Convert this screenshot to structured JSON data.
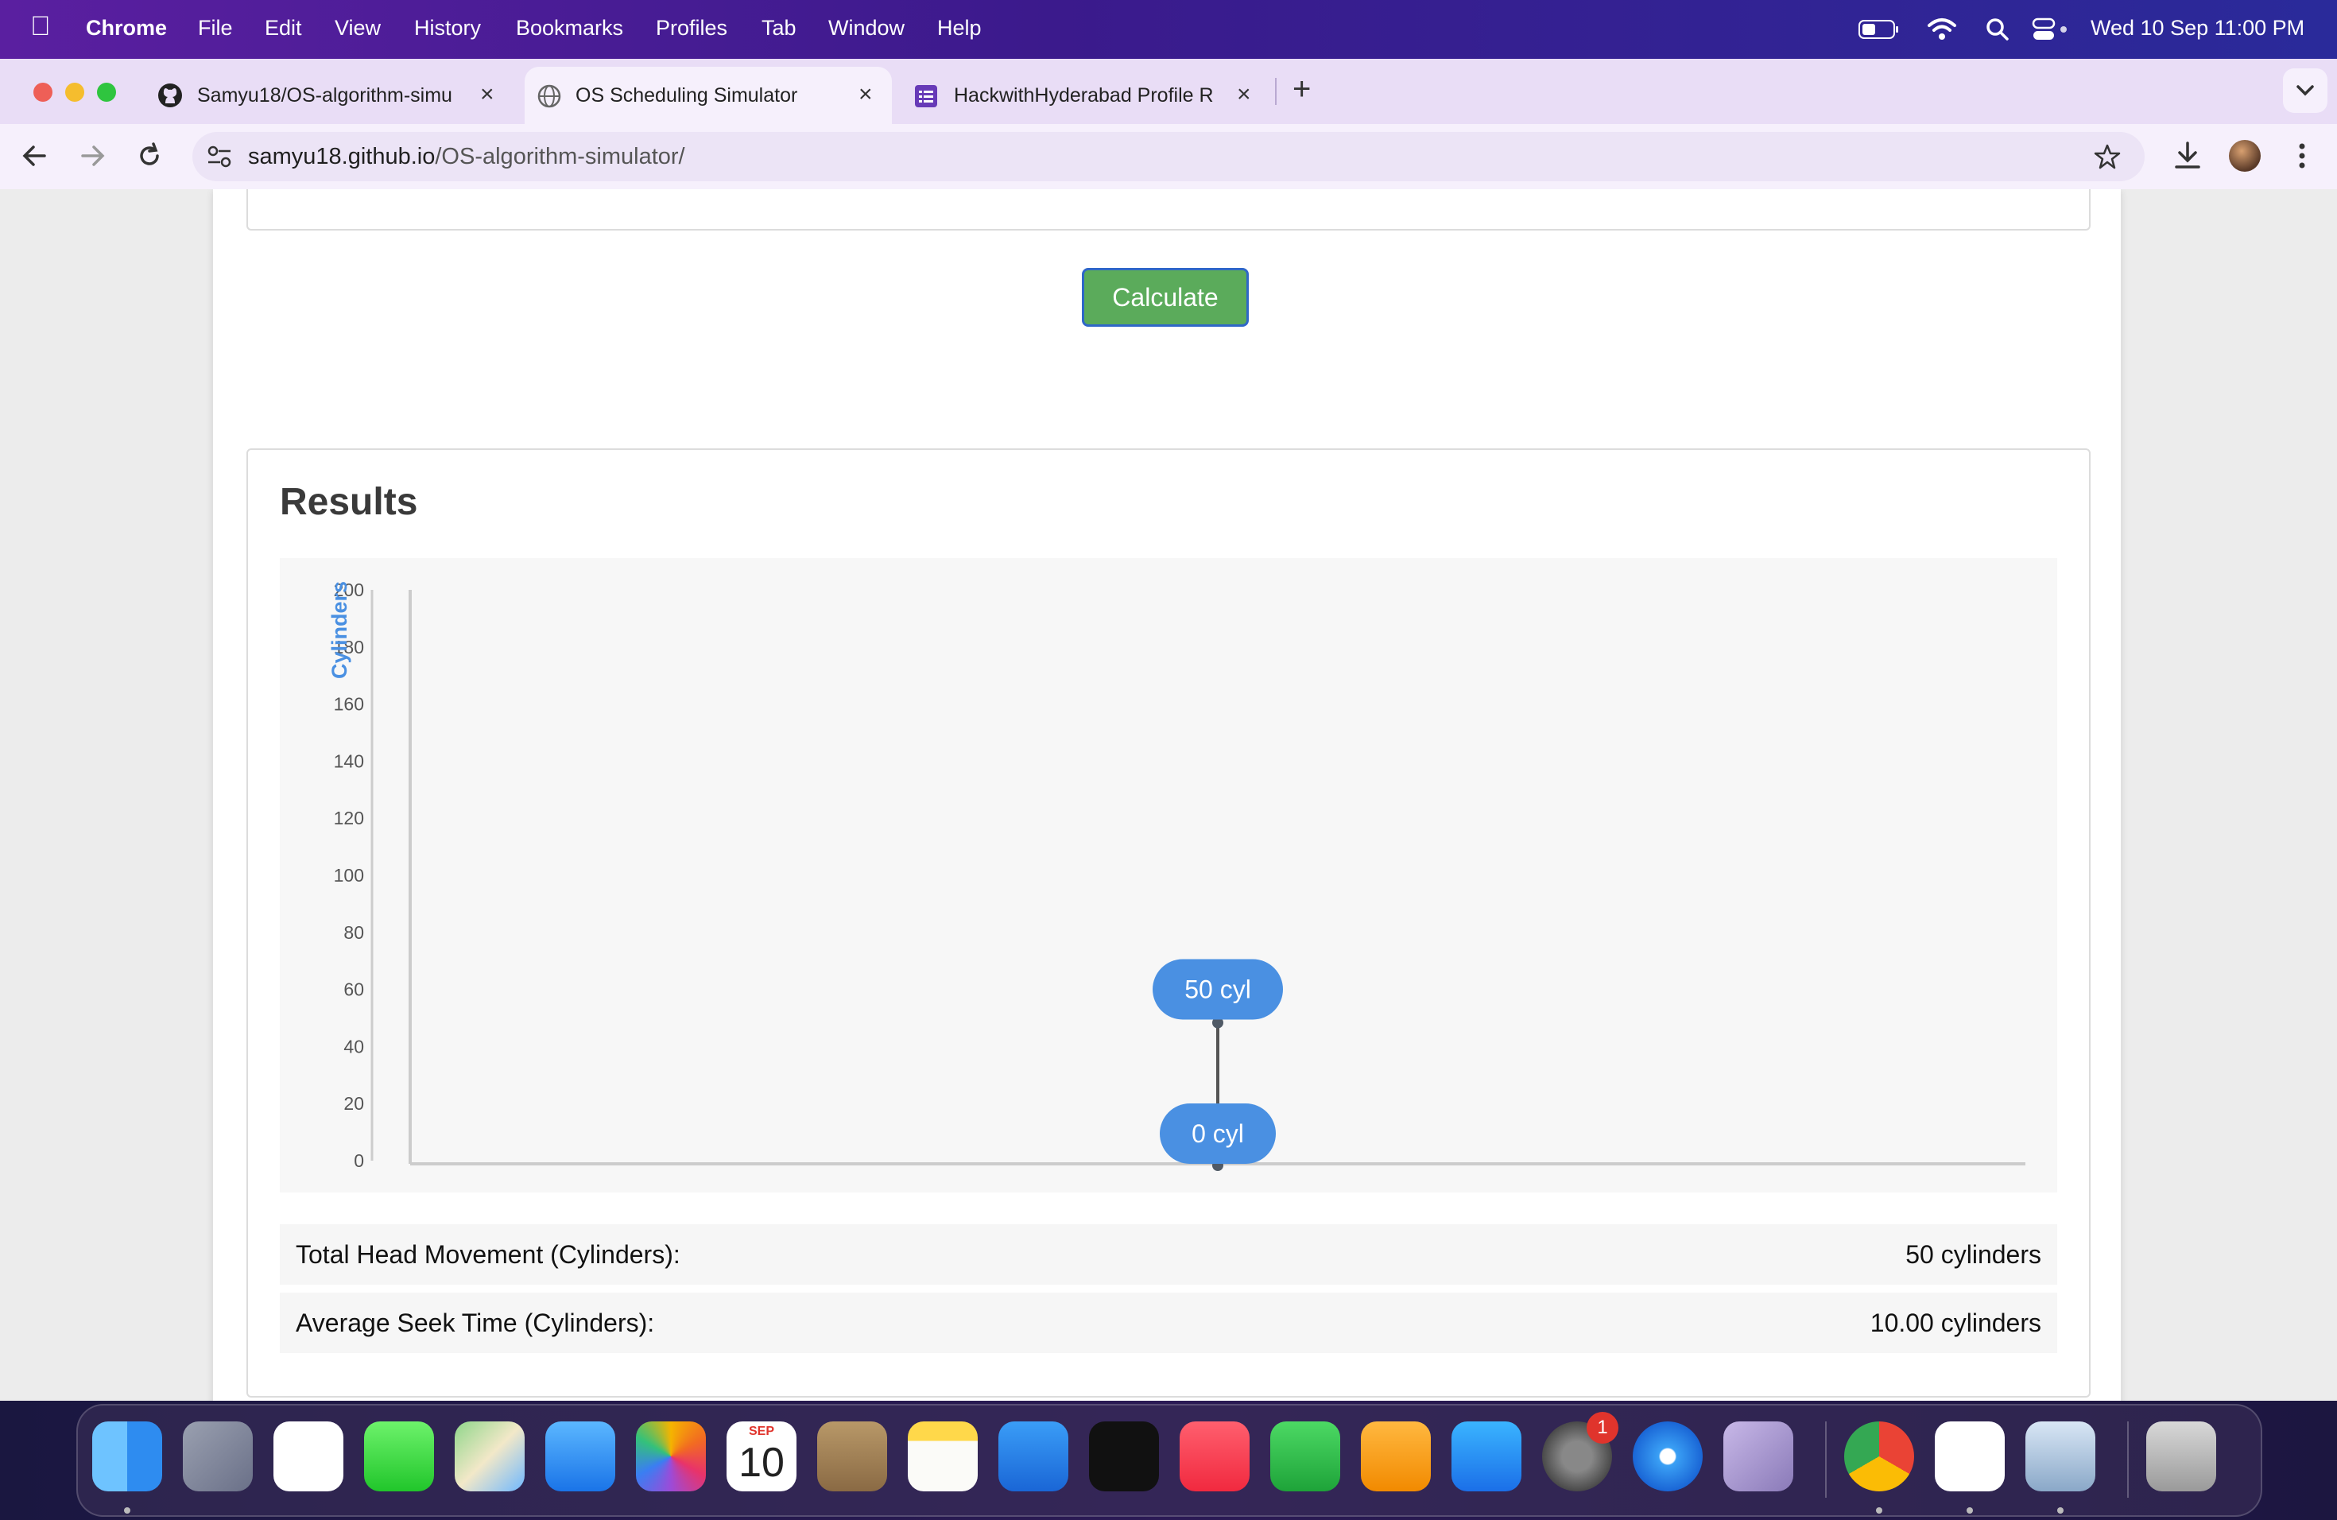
{
  "menubar": {
    "app_name": "Chrome",
    "items": [
      "File",
      "Edit",
      "View",
      "History",
      "Bookmarks",
      "Profiles",
      "Tab",
      "Window",
      "Help"
    ],
    "datetime": "Wed 10 Sep  11:00 PM"
  },
  "tabs": [
    {
      "title": "Samyu18/OS-algorithm-simul",
      "icon": "github-icon",
      "active": false
    },
    {
      "title": "OS Scheduling Simulator",
      "icon": "globe-icon",
      "active": true
    },
    {
      "title": "HackwithHyderabad Profile R",
      "icon": "forms-icon",
      "active": false
    }
  ],
  "address_bar": {
    "host": "samyu18.github.io",
    "path": "/OS-algorithm-simulator/"
  },
  "page": {
    "calculate_label": "Calculate",
    "results_title": "Results",
    "metrics": [
      {
        "label": "Total Head Movement (Cylinders):",
        "value": "50 cylinders"
      },
      {
        "label": "Average Seek Time (Cylinders):",
        "value": "10.00 cylinders"
      }
    ]
  },
  "chart_data": {
    "type": "line",
    "ylabel": "Cylinders",
    "xlabel": "",
    "ylim": [
      0,
      200
    ],
    "yticks": [
      0,
      20,
      40,
      60,
      80,
      100,
      120,
      140,
      160,
      180,
      200
    ],
    "grid": false,
    "series": [
      {
        "points": [
          {
            "y": 50,
            "label": "50 cyl"
          },
          {
            "y": 0,
            "label": "0 cyl"
          }
        ]
      }
    ],
    "colors": {
      "bubble": "#4a90e2",
      "line": "#555555",
      "axis": "#cccccc"
    }
  },
  "dock": {
    "apps": [
      "finder-icon",
      "launchpad-icon",
      "reminders-icon",
      "messages-icon",
      "maps-icon",
      "mail-icon",
      "photos-icon",
      "calendar-icon",
      "contacts-icon",
      "notes-icon",
      "keynote-icon",
      "tv-icon",
      "music-icon",
      "numbers-icon",
      "pages-icon",
      "app-store-icon",
      "system-settings-icon",
      "safari-icon",
      "iphone-mirroring-icon",
      "chrome-icon",
      "vscode-icon",
      "preview-icon",
      "trash-icon"
    ],
    "calendar_month": "SEP",
    "calendar_day": "10",
    "settings_badge": "1"
  }
}
